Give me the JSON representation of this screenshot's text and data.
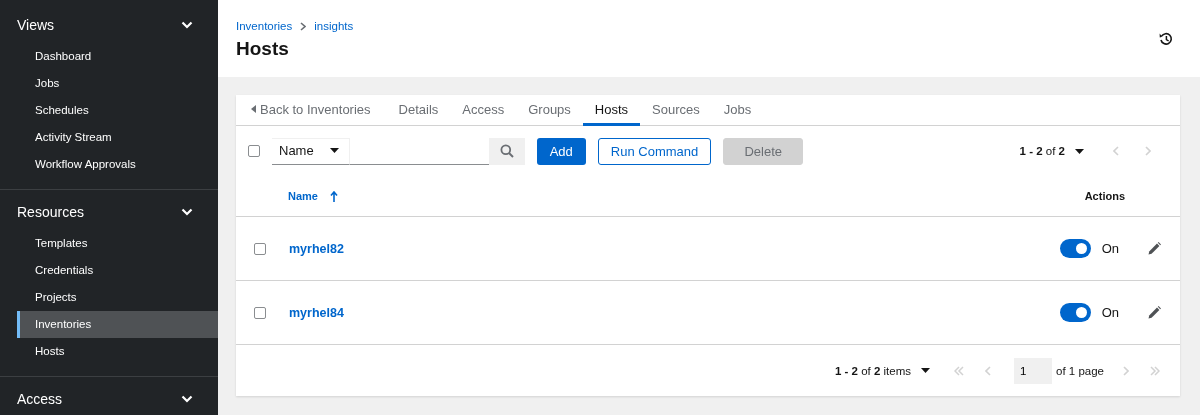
{
  "sidebar": {
    "groups": [
      {
        "label": "Views",
        "items": [
          {
            "label": "Dashboard",
            "selected": false
          },
          {
            "label": "Jobs",
            "selected": false
          },
          {
            "label": "Schedules",
            "selected": false
          },
          {
            "label": "Activity Stream",
            "selected": false
          },
          {
            "label": "Workflow Approvals",
            "selected": false
          }
        ]
      },
      {
        "label": "Resources",
        "items": [
          {
            "label": "Templates",
            "selected": false
          },
          {
            "label": "Credentials",
            "selected": false
          },
          {
            "label": "Projects",
            "selected": false
          },
          {
            "label": "Inventories",
            "selected": true
          },
          {
            "label": "Hosts",
            "selected": false
          }
        ]
      },
      {
        "label": "Access"
      }
    ]
  },
  "breadcrumb": [
    "Inventories",
    "insights"
  ],
  "page_title": "Hosts",
  "tabs": [
    {
      "label": "Back to Inventories",
      "kind": "back",
      "selected": false
    },
    {
      "label": "Details",
      "kind": "tab",
      "selected": false
    },
    {
      "label": "Access",
      "kind": "tab",
      "selected": false
    },
    {
      "label": "Groups",
      "kind": "tab",
      "selected": false
    },
    {
      "label": "Hosts",
      "kind": "tab",
      "selected": true
    },
    {
      "label": "Sources",
      "kind": "tab",
      "selected": false
    },
    {
      "label": "Jobs",
      "kind": "tab",
      "selected": false
    }
  ],
  "toolbar": {
    "select_all_checked": false,
    "filter_attribute": "Name",
    "buttons": [
      {
        "label": "Add",
        "kind": "primary",
        "disabled": false
      },
      {
        "label": "Run Command",
        "kind": "secondary",
        "disabled": false
      },
      {
        "label": "Delete",
        "kind": "danger",
        "disabled": true
      }
    ],
    "pagination": "**1 - 2** of **2**"
  },
  "table": {
    "columns": [
      "Name",
      "Actions"
    ],
    "rows": [
      {
        "checked": false,
        "name": "myrhel82",
        "enabled": true,
        "toggle_label": "On"
      },
      {
        "checked": false,
        "name": "myrhel84",
        "enabled": true,
        "toggle_label": "On"
      }
    ]
  },
  "footer": {
    "items": "**1 - 2** of **2** items",
    "page": "1",
    "page_count": "of 1 page"
  }
}
